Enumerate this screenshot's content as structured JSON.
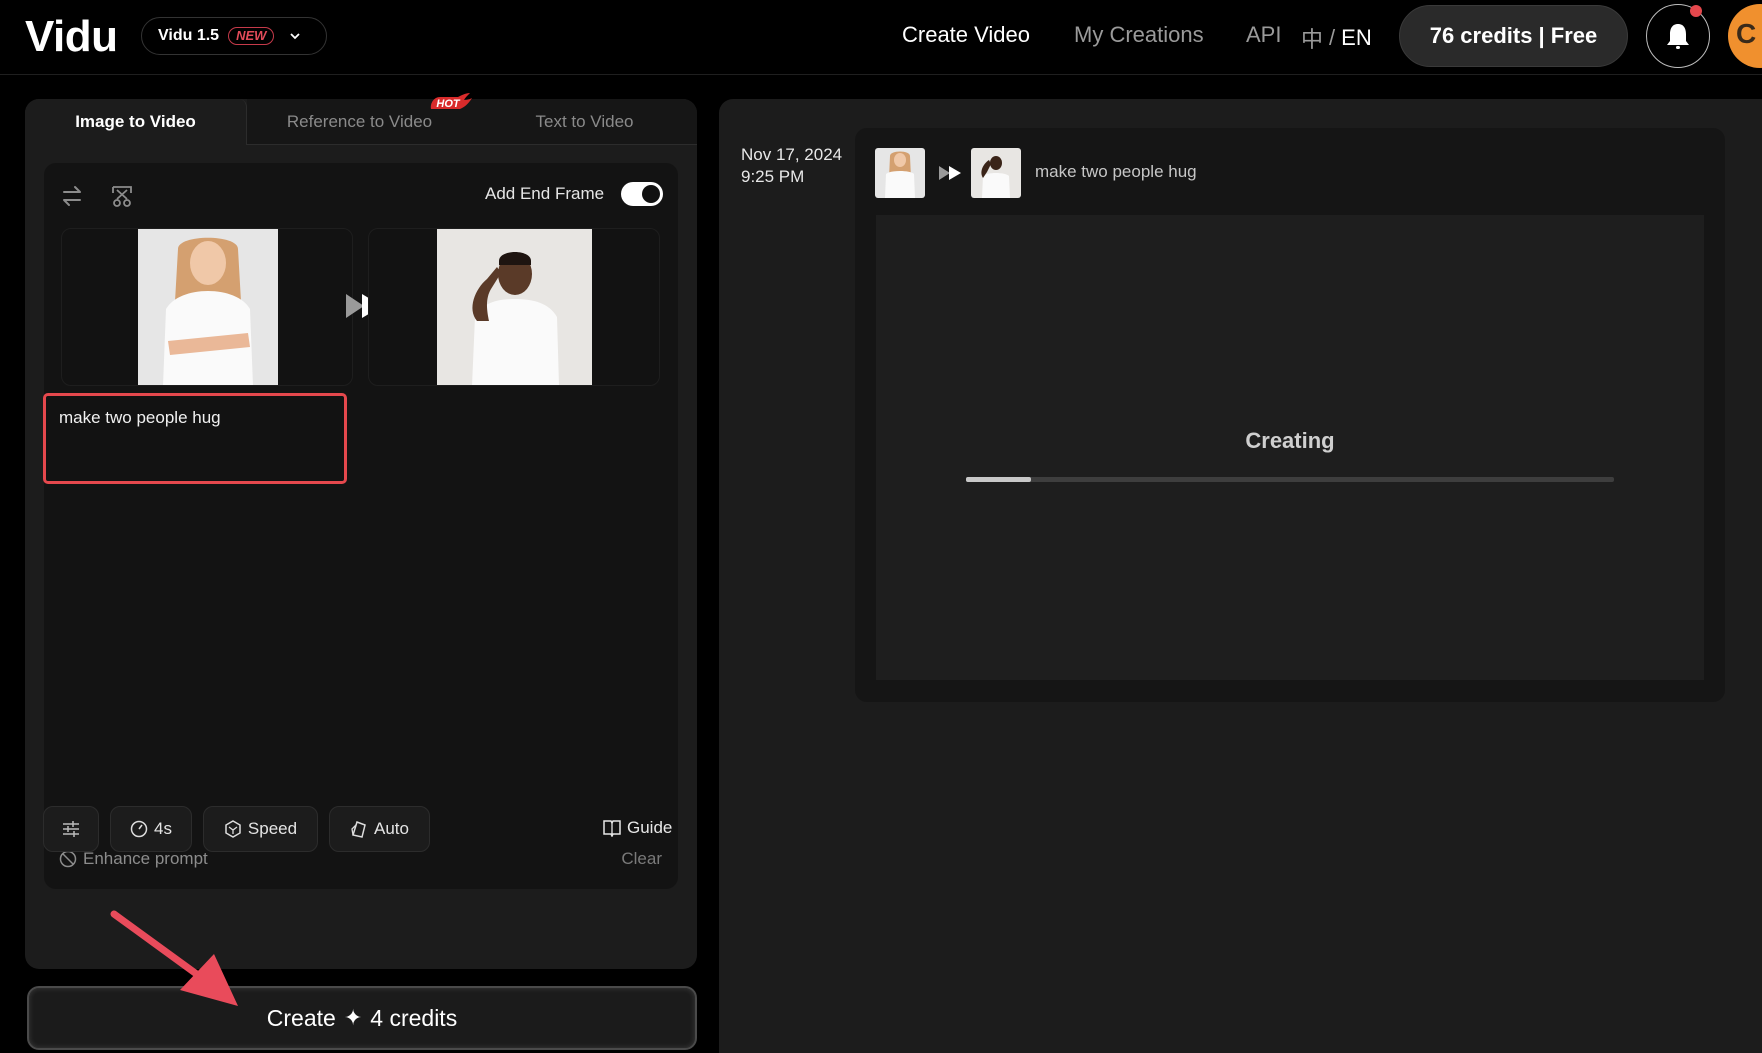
{
  "topbar": {
    "logo": "Vidu",
    "model": {
      "name": "Vidu 1.5",
      "badge": "NEW"
    },
    "nav": {
      "create_video": "Create Video",
      "my_creations": "My Creations",
      "api": "API",
      "lang_zh": "中",
      "lang_sep": "/",
      "lang_en": "EN"
    },
    "credits": "76 credits | Free",
    "notification_dot": true,
    "avatar_initial": "C"
  },
  "left_panel": {
    "tabs": [
      {
        "label": "Image to Video",
        "active": true
      },
      {
        "label": "Reference to Video",
        "active": false,
        "badge": "HOT"
      },
      {
        "label": "Text to Video",
        "active": false
      }
    ],
    "tools": {
      "swap_icon": "swap-arrows",
      "crop_icon": "scissors-frame"
    },
    "add_end_frame": {
      "label": "Add End Frame",
      "enabled": true
    },
    "frames": {
      "start": "woman in white t-shirt, arms crossed",
      "end": "man in white t-shirt, hand on head"
    },
    "prompt": "make two people hug",
    "enhance_prompt": "Enhance prompt",
    "clear": "Clear",
    "options": {
      "duration": "4s",
      "speed": "Speed",
      "aspect": "Auto",
      "guide": "Guide"
    },
    "create_button": {
      "label": "Create",
      "spark": "✦",
      "cost": "4 credits"
    }
  },
  "right_panel": {
    "date": "Nov 17, 2024",
    "time": "9:25 PM",
    "prompt": "make two people hug",
    "status": "Creating",
    "progress_percent": 10
  },
  "colors": {
    "accent_red": "#e5484d",
    "avatar_orange": "#f0902e"
  }
}
